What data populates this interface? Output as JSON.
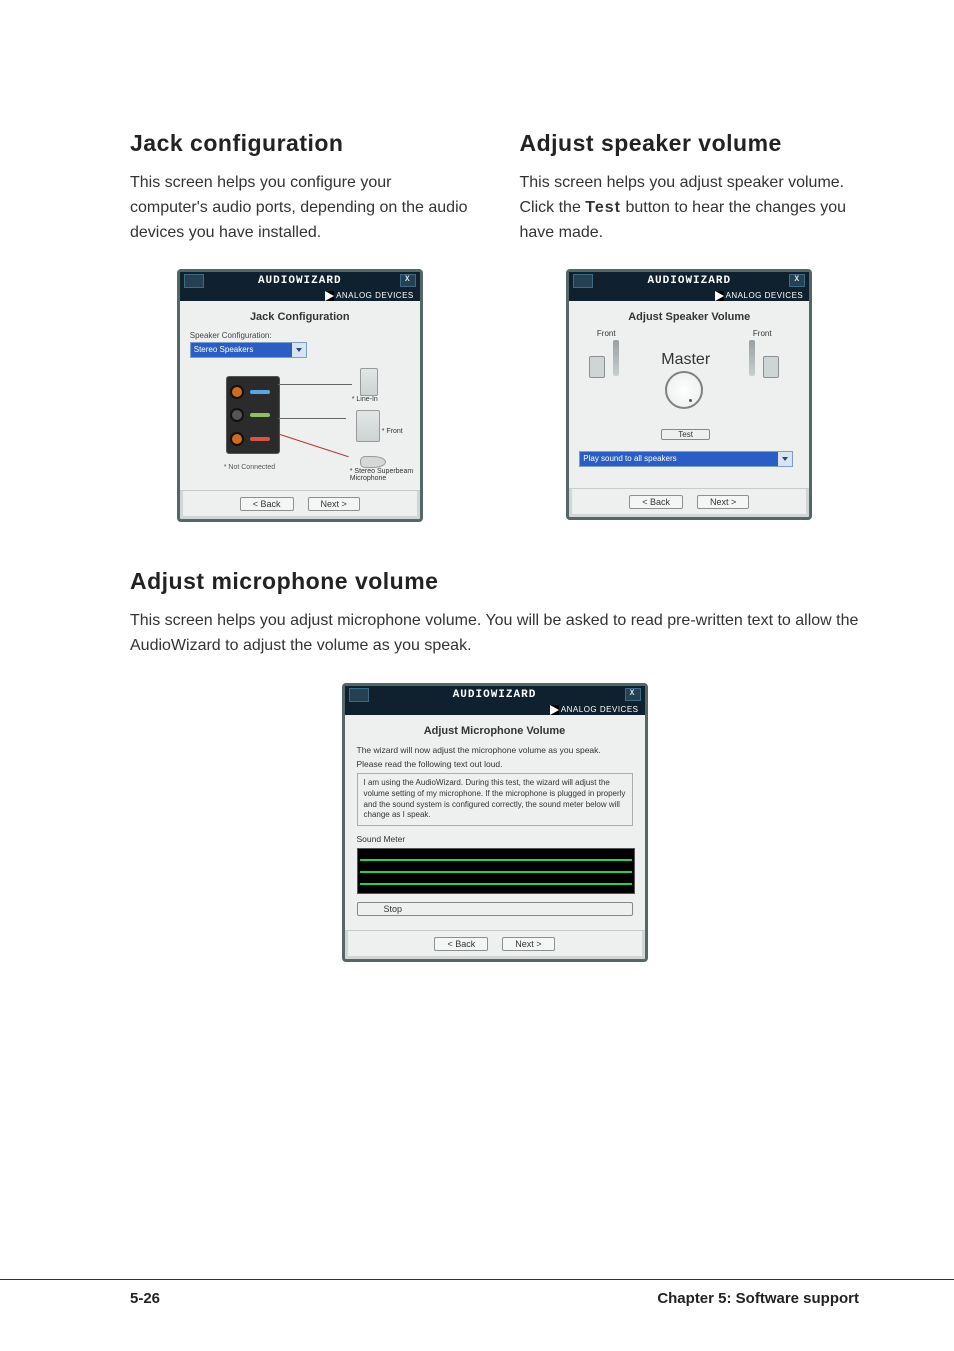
{
  "sections": {
    "jack": {
      "heading": "Jack configuration",
      "body": "This screen helps you configure your computer's audio ports, depending on the audio devices you have installed."
    },
    "speaker": {
      "heading": "Adjust speaker volume",
      "body_pre": "This screen helps you adjust speaker volume. Click the ",
      "body_bold": "Test",
      "body_post": " button to hear the changes you have made."
    },
    "mic": {
      "heading": "Adjust microphone volume",
      "body": "This screen helps you adjust microphone volume. You will be asked to read pre-written text to allow the AudioWizard to adjust the volume as you speak."
    }
  },
  "dialog_common": {
    "title": "AUDIOWIZARD",
    "brand": "ANALOG DEVICES",
    "back": "< Back",
    "next": "Next >"
  },
  "jack_dialog": {
    "subtitle": "Jack Configuration",
    "speaker_cfg_label": "Speaker Configuration:",
    "speaker_cfg_value": "Stereo Speakers",
    "line_in": "* Line-In",
    "front": "* Front",
    "mic": "* Stereo Superbeam Microphone",
    "not_connected": "* Not Connected"
  },
  "speaker_dialog": {
    "subtitle": "Adjust Speaker Volume",
    "front": "Front",
    "master": "Master",
    "test": "Test",
    "play": "Play sound to all speakers"
  },
  "mic_dialog": {
    "subtitle": "Adjust Microphone Volume",
    "line1": "The wizard will now adjust the microphone volume as you speak.",
    "line2": "Please read the following text out loud.",
    "paragraph": "I am using the AudioWizard. During this test, the wizard will adjust the volume setting of my microphone. If the microphone is plugged in properly and the sound system is configured correctly, the sound meter below will change as I speak.",
    "sound_meter": "Sound Meter",
    "stop": "Stop"
  },
  "footer": {
    "page": "5-26",
    "chapter": "Chapter 5: Software support"
  }
}
